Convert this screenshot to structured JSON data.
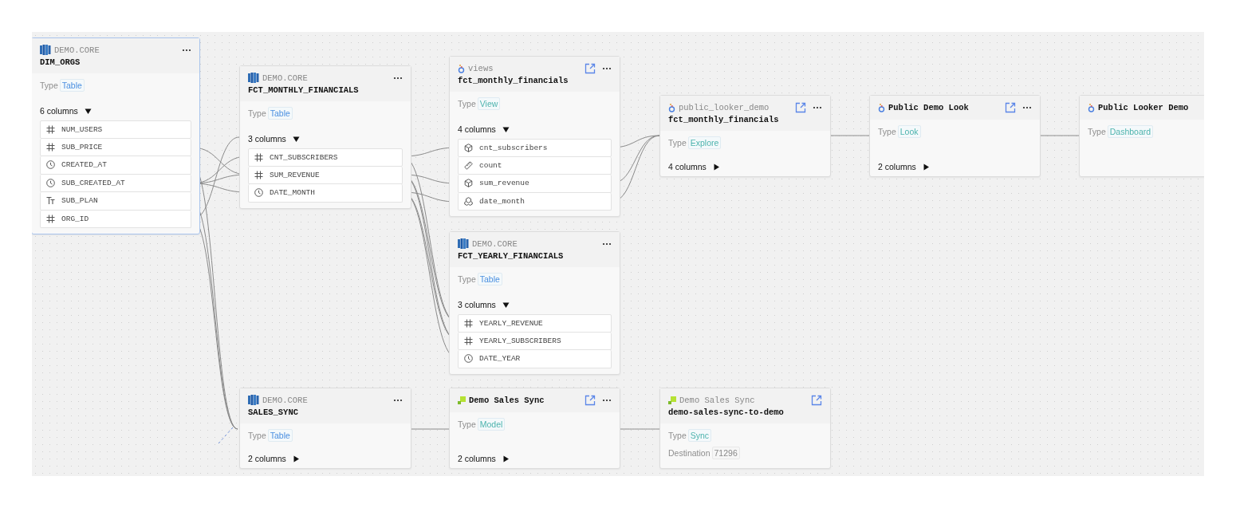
{
  "nodes": [
    {
      "kind": "warehouse",
      "subtitle": "DEMO.CORE",
      "title": "DIM_ORGS",
      "selected": true,
      "open_link": false,
      "menu": true,
      "type_label": "Type",
      "type": "Table",
      "color": "#4a8fe0",
      "columns_label": "6 columns",
      "expanded": true,
      "columns": [
        {
          "kind": "number",
          "name": "NUM_USERS"
        },
        {
          "kind": "number",
          "name": "SUB_PRICE"
        },
        {
          "kind": "time",
          "name": "CREATED_AT"
        },
        {
          "kind": "time",
          "name": "SUB_CREATED_AT"
        },
        {
          "kind": "text",
          "name": "SUB_PLAN"
        },
        {
          "kind": "number",
          "name": "ORG_ID"
        }
      ]
    },
    {
      "kind": "warehouse",
      "subtitle": "DEMO.CORE",
      "title": "FCT_MONTHLY_FINANCIALS",
      "selected": false,
      "open_link": false,
      "menu": true,
      "type_label": "Type",
      "type": "Table",
      "color": "#4a8fe0",
      "columns_label": "3 columns",
      "expanded": true,
      "columns": [
        {
          "kind": "number",
          "name": "CNT_SUBSCRIBERS"
        },
        {
          "kind": "number",
          "name": "SUM_REVENUE"
        },
        {
          "kind": "time",
          "name": "DATE_MONTH"
        }
      ]
    },
    {
      "kind": "bi",
      "subtitle": "views",
      "title": "fct_monthly_financials",
      "selected": false,
      "open_link": true,
      "menu": true,
      "type_label": "Type",
      "type": "View",
      "color": "#4db3ad",
      "columns_label": "4 columns",
      "expanded": true,
      "columns": [
        {
          "kind": "dimension",
          "name": "cnt_subscribers"
        },
        {
          "kind": "measure",
          "name": "count"
        },
        {
          "kind": "dimension",
          "name": "sum_revenue"
        },
        {
          "kind": "dimension_group",
          "name": "date_month"
        }
      ]
    },
    {
      "kind": "bi",
      "subtitle": "public_looker_demo",
      "title": "fct_monthly_financials",
      "selected": false,
      "open_link": true,
      "menu": true,
      "type_label": "Type",
      "type": "Explore",
      "color": "#4db3ad",
      "columns_label": "4 columns",
      "expanded": false
    },
    {
      "kind": "bi",
      "title": "Public Demo Look",
      "selected": false,
      "open_link": true,
      "menu": true,
      "type_label": "Type",
      "type": "Look",
      "color": "#4db3ad",
      "columns_label": "2 columns",
      "expanded": false
    },
    {
      "kind": "bi",
      "title": "Public Looker Demo",
      "selected": false,
      "open_link": false,
      "menu": false,
      "type_label": "Type",
      "type": "Dashboard",
      "color": "#4db3ad"
    },
    {
      "kind": "warehouse",
      "subtitle": "DEMO.CORE",
      "title": "FCT_YEARLY_FINANCIALS",
      "selected": false,
      "open_link": false,
      "menu": true,
      "type_label": "Type",
      "type": "Table",
      "color": "#4a8fe0",
      "columns_label": "3 columns",
      "expanded": true,
      "columns": [
        {
          "kind": "number",
          "name": "YEARLY_REVENUE"
        },
        {
          "kind": "number",
          "name": "YEARLY_SUBSCRIBERS"
        },
        {
          "kind": "time",
          "name": "DATE_YEAR"
        }
      ]
    },
    {
      "kind": "warehouse",
      "subtitle": "DEMO.CORE",
      "title": "SALES_SYNC",
      "selected": false,
      "open_link": false,
      "menu": true,
      "type_label": "Type",
      "type": "Table",
      "color": "#4a8fe0",
      "columns_label": "2 columns",
      "expanded": false
    },
    {
      "kind": "sync",
      "title": "Demo Sales Sync",
      "selected": false,
      "open_link": true,
      "menu": true,
      "type_label": "Type",
      "type": "Model",
      "color": "#4db3ad",
      "columns_label": "2 columns",
      "expanded": false
    },
    {
      "kind": "sync",
      "subtitle": "Demo Sales Sync",
      "title": "demo-sales-sync-to-demo",
      "selected": false,
      "open_link": true,
      "menu": false,
      "type_label": "Type",
      "type": "Sync",
      "color": "#4db3ad",
      "detail_label": "Destination",
      "detail_value": "71296"
    }
  ]
}
